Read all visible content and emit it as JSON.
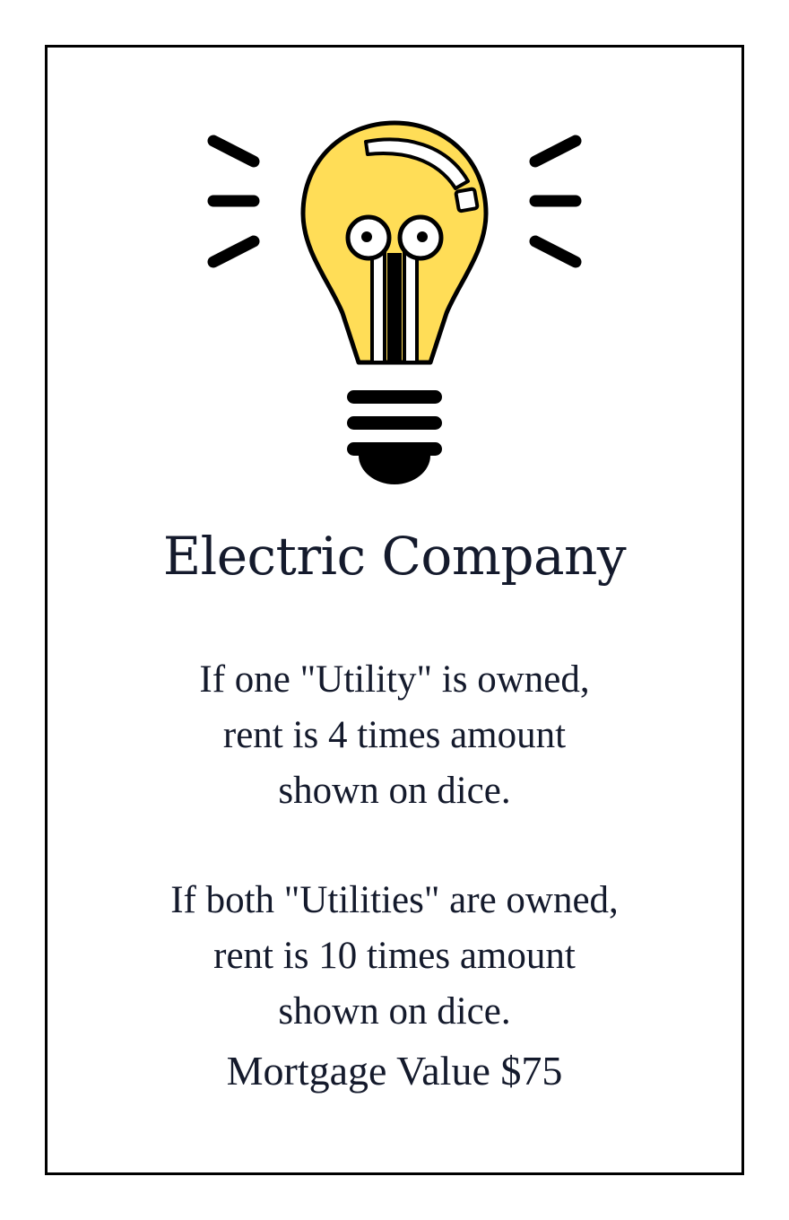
{
  "card": {
    "title": "Electric Company",
    "icon": "lightbulb-icon",
    "rule_one_lines": [
      "If one \"Utility\" is owned,",
      "rent is 4 times amount",
      "shown on dice."
    ],
    "rule_both_lines": [
      "If both \"Utilities\" are owned,",
      "rent is 10 times amount",
      "shown on dice."
    ],
    "mortgage": "Mortgage Value $75"
  },
  "colors": {
    "bulb_fill": "#FFDD57",
    "ink": "#000000",
    "text": "#141A2C"
  }
}
